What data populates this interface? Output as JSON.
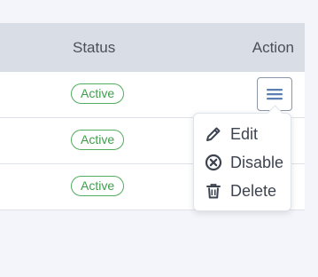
{
  "table": {
    "headers": {
      "status": "Status",
      "action": "Action"
    },
    "rows": [
      {
        "status": "Active"
      },
      {
        "status": "Active"
      },
      {
        "status": "Active"
      }
    ]
  },
  "action_menu": {
    "trigger_icon": "hamburger-menu-icon",
    "items": [
      {
        "label": "Edit",
        "icon": "pencil-icon"
      },
      {
        "label": "Disable",
        "icon": "circle-x-icon"
      },
      {
        "label": "Delete",
        "icon": "trash-icon"
      }
    ]
  },
  "colors": {
    "header_bg": "#d9dde5",
    "badge_green": "#52ad5e",
    "icon_dark": "#3d4450",
    "menu_icon_blue": "#5b7fb3"
  }
}
